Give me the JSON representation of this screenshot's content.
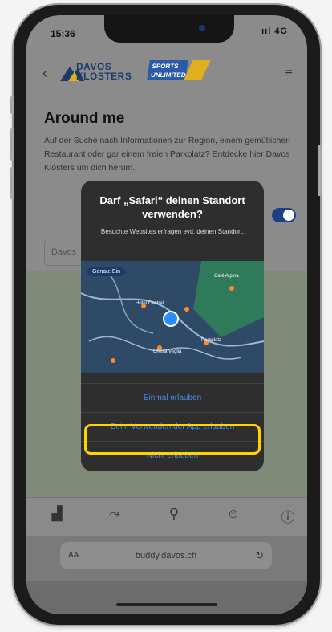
{
  "status": {
    "time": "15:36",
    "signal": "ııl 4G"
  },
  "header": {
    "back_icon": "chevron-left-icon",
    "brand_line1": "DAVOS",
    "brand_line2": "KLOSTERS",
    "partner_line1": "SPORTS",
    "partner_line2": "UNLIMITED",
    "menu_icon": "hamburger-menu-icon"
  },
  "page": {
    "title": "Around me",
    "intro": "Auf der Suche nach Informationen zur Region, einem gemütlichen Restaurant oder gar einem freien Parkplatz? Entdecke hier Davos Klosters um dich herum.",
    "search_placeholder": "Davos"
  },
  "dialog": {
    "title": "Darf „Safari“ deinen Standort verwenden?",
    "message": "Besuchte Websites erfragen evtl. deinen Standort.",
    "map_badge": "Genau: Ein",
    "map_places": [
      "Café Alpina",
      "Hotel Central",
      "Chesa Veglia",
      "Parkplatz"
    ],
    "buttons": [
      "Einmal erlauben",
      "Beim Verwenden der App erlauben",
      "Nicht erlauben"
    ]
  },
  "tabbar": {
    "icons": [
      "chart-icon",
      "route-icon",
      "map-pin-icon",
      "user-icon",
      "info-icon"
    ]
  },
  "browser": {
    "aa": "AA",
    "url": "buddy.davos.ch",
    "reload_icon": "reload-icon"
  },
  "colors": {
    "dialog_bg": "#2e2e2e",
    "link": "#4a8ae8",
    "highlight": "#ffd400",
    "brand": "#1d3b6a",
    "partner": "#2a5aa8"
  }
}
